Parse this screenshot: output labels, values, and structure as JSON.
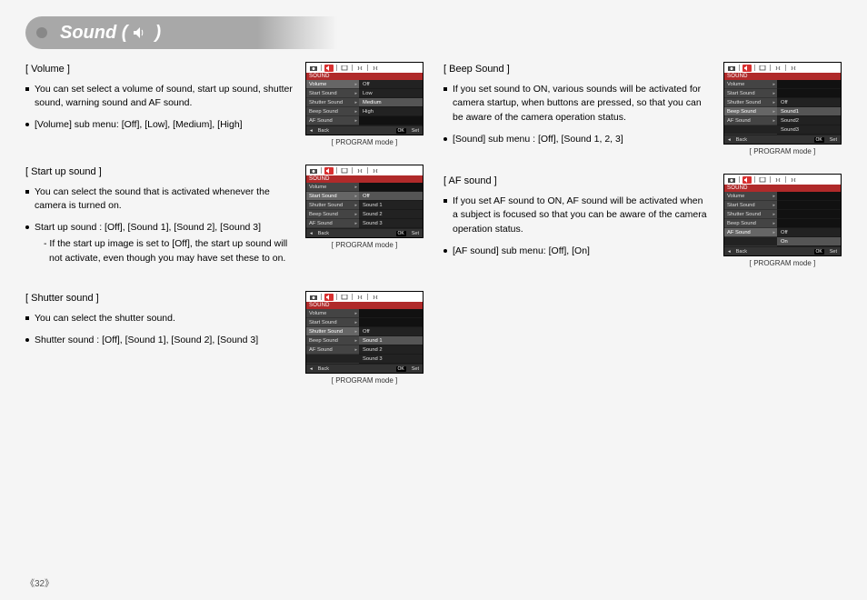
{
  "header": {
    "title_left": "Sound (",
    "title_right": ")"
  },
  "pageNumber": "《32》",
  "menuCaption": "[ PROGRAM mode ]",
  "menuTitle": "SOUND",
  "menuFoot": {
    "back": "Back",
    "ok": "OK",
    "set": "Set"
  },
  "sections": {
    "volume": {
      "title": "[ Volume ]",
      "p1": "You can set select a volume of sound, start up sound, shutter sound, warning sound and AF sound.",
      "p2": "[Volume] sub menu: [Off], [Low], [Medium], [High]",
      "menu": {
        "rows": [
          {
            "l": "Volume",
            "active": true,
            "r": "Off"
          },
          {
            "l": "Start Sound",
            "r": "Low"
          },
          {
            "l": "Shutter Sound",
            "r": "Medium",
            "sel": true
          },
          {
            "l": "Beep Sound",
            "r": "High"
          },
          {
            "l": "AF Sound",
            "r": ""
          }
        ]
      }
    },
    "startup": {
      "title": "[ Start up sound ]",
      "p1": "You can select the sound that is activated whenever the camera is turned on.",
      "p2": "Start up sound : [Off], [Sound 1], [Sound 2], [Sound 3]",
      "note": "- If the start up image is set to [Off], the start up sound will not activate, even though you may have set these to on.",
      "menu": {
        "rows": [
          {
            "l": "Volume",
            "r": ""
          },
          {
            "l": "Start Sound",
            "active": true,
            "r": "Off",
            "sel": true
          },
          {
            "l": "Shutter Sound",
            "r": "Sound 1"
          },
          {
            "l": "Beep Sound",
            "r": "Sound 2"
          },
          {
            "l": "AF Sound",
            "r": "Sound 3"
          }
        ]
      }
    },
    "shutter": {
      "title": "[ Shutter sound ]",
      "p1": "You can select the shutter sound.",
      "p2": "Shutter sound : [Off], [Sound 1], [Sound 2], [Sound 3]",
      "menu": {
        "rows": [
          {
            "l": "Volume",
            "r": ""
          },
          {
            "l": "Start Sound",
            "r": ""
          },
          {
            "l": "Shutter Sound",
            "active": true,
            "r": "Off"
          },
          {
            "l": "Beep Sound",
            "r": "Sound 1",
            "sel": true
          },
          {
            "l": "AF Sound",
            "r": "Sound 2"
          },
          {
            "l": "",
            "r": "Sound 3"
          }
        ]
      }
    },
    "beep": {
      "title": "[ Beep Sound ]",
      "p1": "If you set sound to ON, various sounds will be activated for camera startup, when buttons are pressed, so that you can be aware of the camera operation status.",
      "p2": "[Sound] sub menu : [Off], [Sound 1, 2, 3]",
      "menu": {
        "rows": [
          {
            "l": "Volume",
            "r": ""
          },
          {
            "l": "Start Sound",
            "r": ""
          },
          {
            "l": "Shutter Sound",
            "r": "Off"
          },
          {
            "l": "Beep Sound",
            "active": true,
            "r": "Sound1",
            "sel": true
          },
          {
            "l": "AF Sound",
            "r": "Sound2"
          },
          {
            "l": "",
            "r": "Sound3"
          }
        ]
      }
    },
    "af": {
      "title": "[ AF sound ]",
      "p1": "If you set AF sound to ON, AF sound will be activated when a subject is focused so that you can be aware of the camera operation status.",
      "p2": "[AF sound] sub menu: [Off], [On]",
      "menu": {
        "rows": [
          {
            "l": "Volume",
            "r": ""
          },
          {
            "l": "Start Sound",
            "r": ""
          },
          {
            "l": "Shutter Sound",
            "r": ""
          },
          {
            "l": "Beep Sound",
            "r": ""
          },
          {
            "l": "AF Sound",
            "active": true,
            "r": "Off"
          },
          {
            "l": "",
            "r": "On",
            "sel": true
          }
        ]
      }
    }
  }
}
